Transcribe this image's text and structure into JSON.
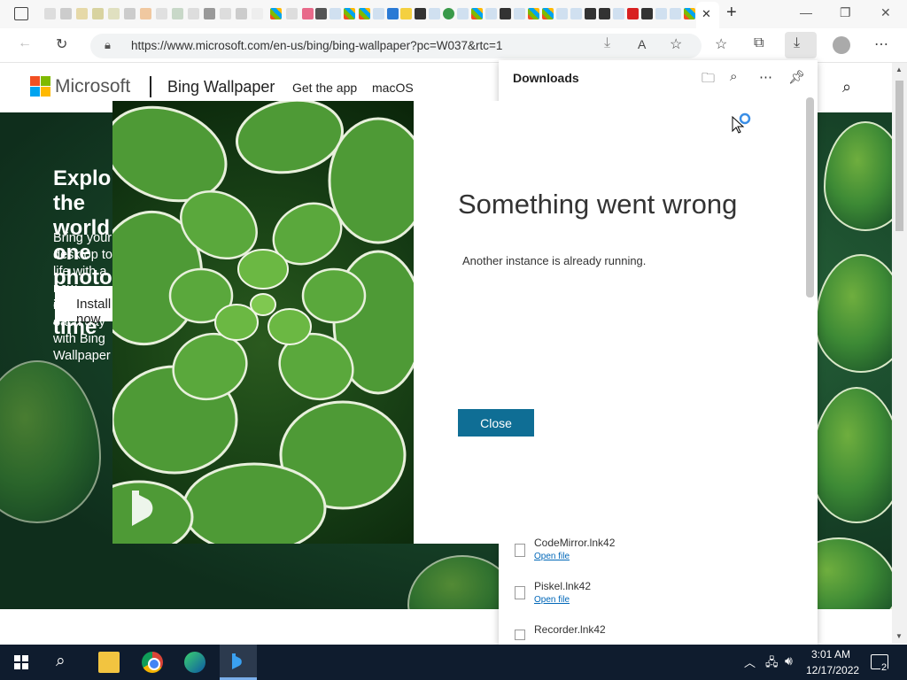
{
  "browser": {
    "url": "https://www.microsoft.com/en-us/bing/bing-wallpaper?pc=W037&rtc=1",
    "tab_close_glyph": "✕",
    "new_tab_glyph": "+"
  },
  "site": {
    "brand": "Microsoft",
    "product": "Bing Wallpaper",
    "nav": [
      "Get the app",
      "macOS"
    ],
    "hero_title": "Explore the world one photo at a time",
    "hero_subtitle": "Bring your desktop to life with a new image each day with Bing Wallpaper",
    "install_label": "Install now"
  },
  "dialog": {
    "title": "Something went wrong",
    "message": "Another instance is already running.",
    "close_label": "Close"
  },
  "downloads": {
    "title": "Downloads",
    "items": [
      {
        "name": "CodeMirror.lnk42",
        "action": "Open file"
      },
      {
        "name": "Piskel.lnk42",
        "action": "Open file"
      },
      {
        "name": "Recorder.lnk42",
        "action": ""
      }
    ]
  },
  "taskbar": {
    "time": "3:01 AM",
    "date": "12/17/2022",
    "notification_count": "2"
  },
  "colors": {
    "accent": "#0f6e95",
    "taskbar": "#0f1c2e"
  }
}
